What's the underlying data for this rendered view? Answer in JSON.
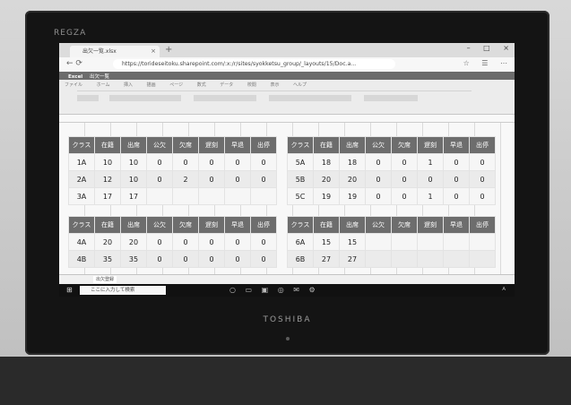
{
  "tv": {
    "brand_top": "REGZA",
    "brand_bottom": "TOSHIBA"
  },
  "browser": {
    "tab_title": "出欠一覧.xlsx",
    "url": "https://torideseitoku.sharepoint.com/:x:/r/sites/syokketsu_group/_layouts/15/Doc.a...",
    "app_bar_name": "Excel",
    "app_bar_file": "出欠一覧"
  },
  "tables": {
    "headers": [
      "クラス",
      "在籍",
      "出席",
      "公欠",
      "欠席",
      "遅刻",
      "早退",
      "出停"
    ],
    "t1": [
      [
        "1A",
        "10",
        "10",
        "0",
        "0",
        "0",
        "0",
        "0"
      ],
      [
        "2A",
        "12",
        "10",
        "0",
        "2",
        "0",
        "0",
        "0"
      ],
      [
        "3A",
        "17",
        "17",
        "",
        "",
        "",
        "",
        ""
      ]
    ],
    "t2": [
      [
        "5A",
        "18",
        "18",
        "0",
        "0",
        "1",
        "0",
        "0"
      ],
      [
        "5B",
        "20",
        "20",
        "0",
        "0",
        "0",
        "0",
        "0"
      ],
      [
        "5C",
        "19",
        "19",
        "0",
        "0",
        "1",
        "0",
        "0"
      ]
    ],
    "t3": [
      [
        "4A",
        "20",
        "20",
        "0",
        "0",
        "0",
        "0",
        "0"
      ],
      [
        "4B",
        "35",
        "35",
        "0",
        "0",
        "0",
        "0",
        "0"
      ]
    ],
    "t4": [
      [
        "6A",
        "15",
        "15",
        "",
        "",
        "",
        "",
        ""
      ],
      [
        "6B",
        "27",
        "27",
        "",
        "",
        "",
        "",
        ""
      ]
    ]
  },
  "sheet_tab": "出欠登録",
  "taskbar": {
    "search_placeholder": "ここに入力して検索",
    "tray": "A"
  }
}
